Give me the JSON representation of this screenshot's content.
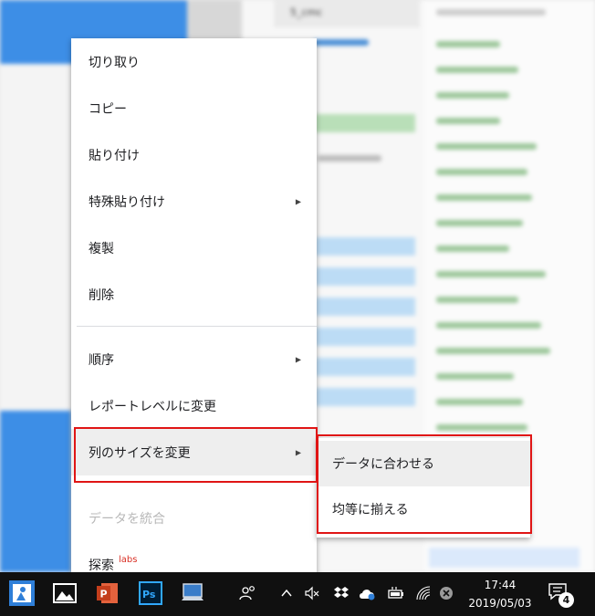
{
  "context_menu": {
    "items": [
      {
        "label": "切り取り"
      },
      {
        "label": "コピー"
      },
      {
        "label": "貼り付け"
      },
      {
        "label": "特殊貼り付け"
      },
      {
        "label": "複製"
      },
      {
        "label": "削除"
      },
      {
        "label": "順序"
      },
      {
        "label": "レポートレベルに変更"
      },
      {
        "label": "列のサイズを変更"
      },
      {
        "label": "データを統合"
      },
      {
        "label": "探索",
        "badge": "labs"
      }
    ]
  },
  "submenu": {
    "items": [
      {
        "label": "データに合わせる"
      },
      {
        "label": "均等に揃える"
      }
    ]
  },
  "background": {
    "tab_fragment": "5_cmc"
  },
  "taskbar": {
    "time": "17:44",
    "date": "2019/05/03",
    "notification_count": "4"
  },
  "colors": {
    "highlight": "#e01515",
    "taskbar": "#101010",
    "menu_hover": "#eeeeee",
    "disabled_text": "#b8b8b8"
  }
}
